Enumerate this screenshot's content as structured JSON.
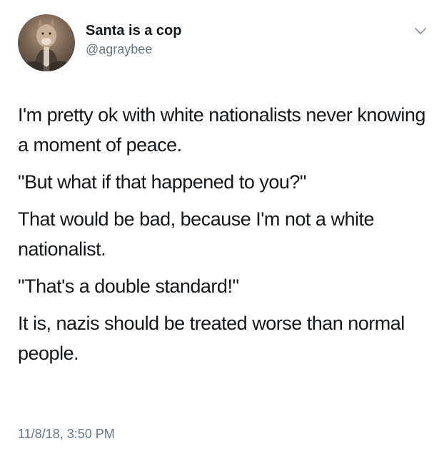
{
  "tweet": {
    "author": {
      "display_name": "Santa is a cop",
      "handle": "@agraybee",
      "avatar_icon": "avatar-photo"
    },
    "menu_icon": "chevron-down-icon",
    "paragraphs": [
      "I'm pretty ok with white nationalists never knowing a moment of peace.",
      "\"But what if that happened to you?\"",
      "That would be bad, because I'm not a white nationalist.",
      "\"That's a double standard!\"",
      "It is, nazis should be treated worse than normal people."
    ],
    "timestamp": "11/8/18, 3:50 PM"
  }
}
